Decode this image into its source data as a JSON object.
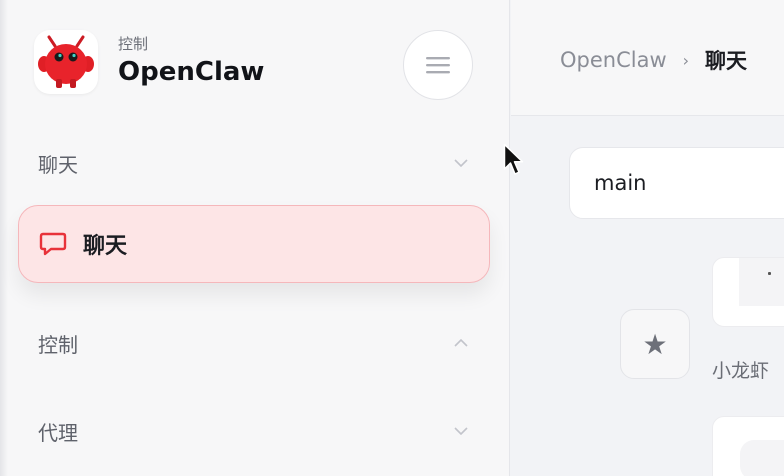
{
  "sidebar": {
    "brand": {
      "subtitle": "控制",
      "title": "OpenClaw"
    },
    "menu_button_icon": "hamburger-menu-icon",
    "sections": [
      {
        "label": "聊天",
        "expanded": true,
        "items": [
          {
            "label": "聊天",
            "icon": "chat-bubble-icon",
            "active": true
          }
        ]
      },
      {
        "label": "控制",
        "expanded": false
      },
      {
        "label": "代理",
        "expanded": false
      }
    ]
  },
  "header": {
    "breadcrumb": {
      "root": "OpenClaw",
      "separator": "›",
      "current": "聊天"
    }
  },
  "main": {
    "session_select": {
      "value": "main"
    },
    "agent_name": "小龙虾",
    "star_icon": "star-icon"
  },
  "colors": {
    "accent": "#e8323a",
    "active_bg": "#fde5e6",
    "active_border": "#f5b7bb",
    "sidebar_bg": "#f7f7f8",
    "content_bg": "#f2f3f6"
  }
}
